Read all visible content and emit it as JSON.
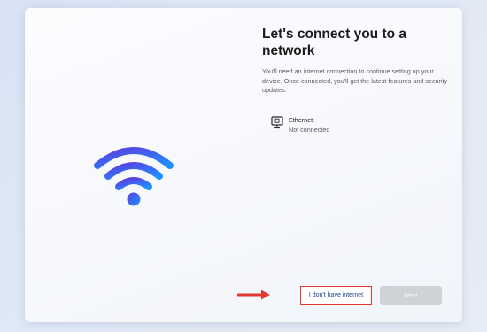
{
  "page": {
    "title": "Let's connect you to a network",
    "description": "You'll need an internet connection to continue setting up your device. Once connected, you'll get the latest features and security updates."
  },
  "network": {
    "icon": "ethernet-monitor-icon",
    "name": "Ethernet",
    "status": "Not connected"
  },
  "hero": {
    "icon": "wifi-icon",
    "gradient": [
      "#5b3fe0",
      "#1e90ff"
    ]
  },
  "actions": {
    "no_internet_label": "I don't have internet",
    "next_label": "Next",
    "highlight_color": "#e23a2f"
  }
}
